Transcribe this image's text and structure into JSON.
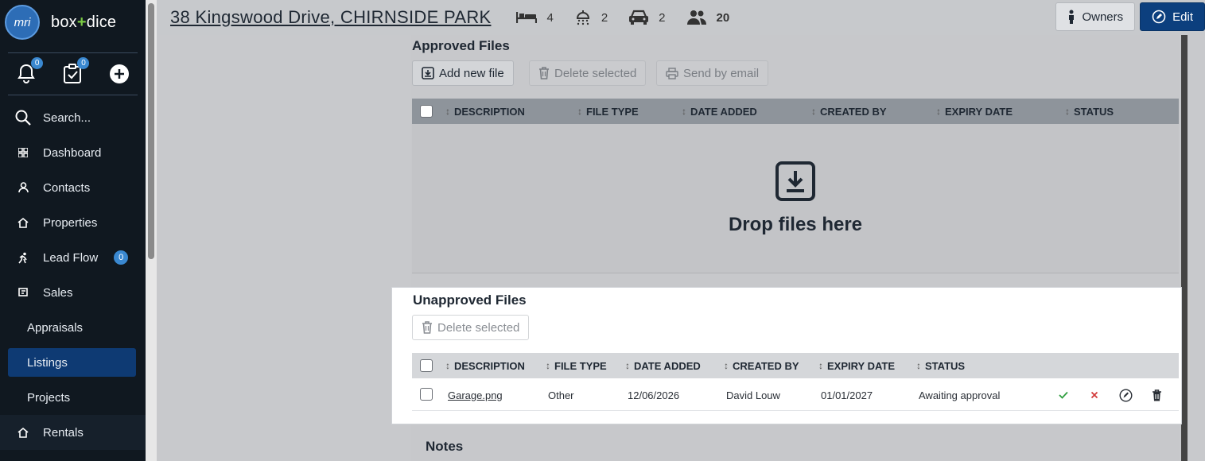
{
  "brand": {
    "logo": "mri",
    "name_left": "box",
    "name_plus": "+",
    "name_right": "dice"
  },
  "quick": {
    "notifications_count": "0",
    "tasks_count": "0"
  },
  "nav": {
    "search": "Search...",
    "dashboard": "Dashboard",
    "contacts": "Contacts",
    "properties": "Properties",
    "lead_flow": "Lead Flow",
    "lead_flow_count": "0",
    "sales": "Sales",
    "appraisals": "Appraisals",
    "listings": "Listings",
    "projects": "Projects",
    "rentals": "Rentals"
  },
  "header": {
    "address": "38 Kingswood Drive, CHIRNSIDE PARK",
    "beds": "4",
    "baths": "2",
    "cars": "2",
    "people": "20",
    "owners_label": "Owners",
    "edit_label": "Edit"
  },
  "approved": {
    "title": "Approved Files",
    "add_label": "Add new file",
    "delete_label": "Delete selected",
    "email_label": "Send by email",
    "columns": [
      "DESCRIPTION",
      "FILE TYPE",
      "DATE ADDED",
      "CREATED BY",
      "EXPIRY DATE",
      "STATUS"
    ],
    "drop_text": "Drop files here"
  },
  "unapproved": {
    "title": "Unapproved Files",
    "delete_label": "Delete selected",
    "columns": [
      "DESCRIPTION",
      "FILE TYPE",
      "DATE ADDED",
      "CREATED BY",
      "EXPIRY DATE",
      "STATUS"
    ],
    "rows": [
      {
        "description": "Garage.png",
        "file_type": "Other",
        "date_added": "12/06/2026",
        "created_by": "David Louw",
        "expiry_date": "01/01/2027",
        "status": "Awaiting approval"
      }
    ]
  },
  "notes": {
    "title": "Notes"
  },
  "colors": {
    "sidebar_bg": "#101820",
    "accent": "#0c3f7e",
    "badge": "#3a88d0",
    "approve": "#2e9e3e",
    "reject": "#d23b3b"
  },
  "icons": [
    "bell-icon",
    "checklist-icon",
    "plus-circle-icon",
    "search-icon",
    "grid-icon",
    "person-icon",
    "house-icon",
    "runner-icon",
    "sales-icon",
    "bed-icon",
    "shower-icon",
    "car-icon",
    "people-icon",
    "owner-icon",
    "edit-icon",
    "download-icon",
    "trash-icon",
    "printer-icon",
    "check-icon",
    "cross-icon",
    "compass-icon"
  ]
}
